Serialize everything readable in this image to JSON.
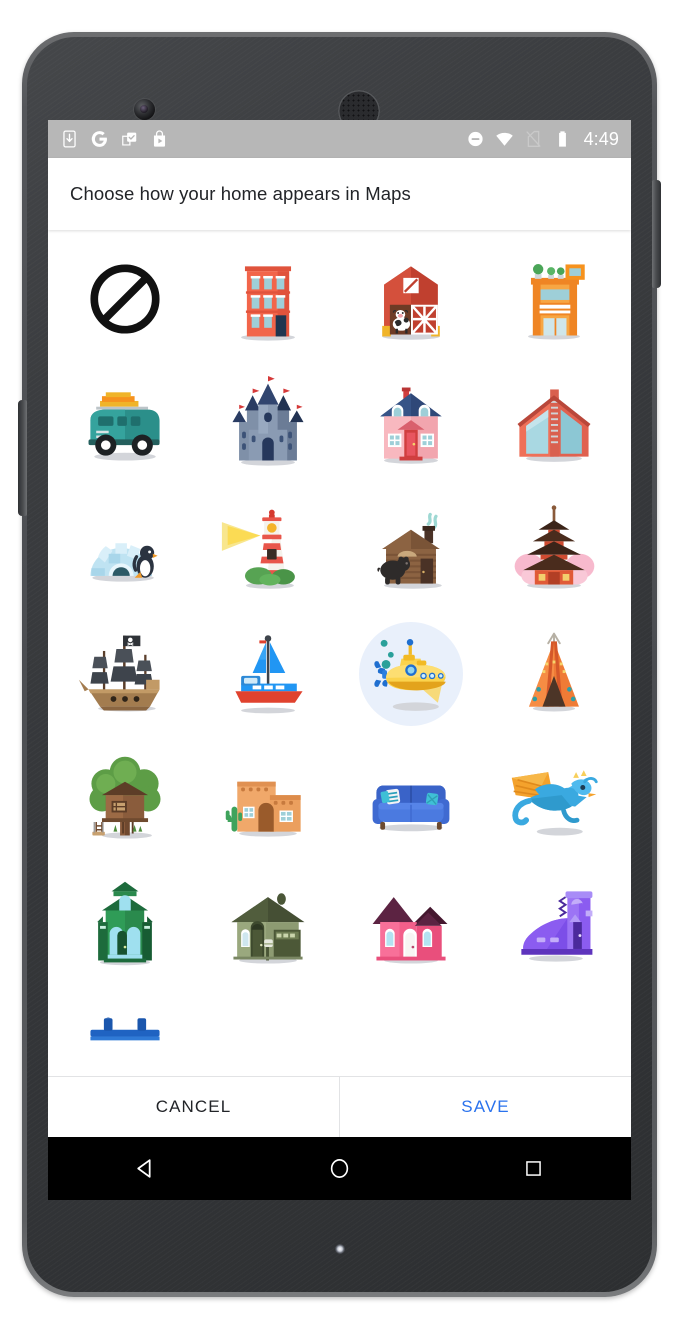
{
  "device": {
    "type": "android-phone",
    "frame_color": "#3b3d40"
  },
  "status_bar": {
    "background": "#b7b7b7",
    "time": "4:49",
    "left_icons": [
      {
        "name": "download-to-device-icon",
        "label": "Download"
      },
      {
        "name": "google-g-icon",
        "label": "Google"
      },
      {
        "name": "app-update-check-icon",
        "label": "App update"
      },
      {
        "name": "play-store-icon",
        "label": "Play Store"
      }
    ],
    "right_icons": [
      {
        "name": "do-not-disturb-icon",
        "label": "Do not disturb"
      },
      {
        "name": "wifi-icon",
        "label": "Wi-Fi"
      },
      {
        "name": "no-sim-icon",
        "label": "No SIM"
      },
      {
        "name": "battery-icon",
        "label": "Battery"
      }
    ]
  },
  "header": {
    "title": "Choose how your home appears in Maps"
  },
  "grid": {
    "columns": 4,
    "selected_index": 14,
    "selection_color": "#e9f0fb",
    "items": [
      {
        "id": "none",
        "label": "None"
      },
      {
        "id": "brownstone",
        "label": "Brownstone apartment"
      },
      {
        "id": "barn",
        "label": "Barn"
      },
      {
        "id": "shop",
        "label": "Shop front"
      },
      {
        "id": "camper-van",
        "label": "Camper van"
      },
      {
        "id": "castle",
        "label": "Castle"
      },
      {
        "id": "suburban-house",
        "label": "Suburban house"
      },
      {
        "id": "modern-house",
        "label": "Modern house"
      },
      {
        "id": "igloo",
        "label": "Igloo"
      },
      {
        "id": "lighthouse",
        "label": "Lighthouse"
      },
      {
        "id": "log-cabin",
        "label": "Log cabin"
      },
      {
        "id": "pagoda",
        "label": "Pagoda"
      },
      {
        "id": "pirate-ship",
        "label": "Pirate ship"
      },
      {
        "id": "sailboat",
        "label": "Sailboat"
      },
      {
        "id": "submarine",
        "label": "Submarine"
      },
      {
        "id": "teepee",
        "label": "Teepee"
      },
      {
        "id": "treehouse",
        "label": "Treehouse"
      },
      {
        "id": "adobe-house",
        "label": "Adobe house"
      },
      {
        "id": "couch",
        "label": "Couch"
      },
      {
        "id": "dragon",
        "label": "Dragon"
      },
      {
        "id": "victorian-house",
        "label": "Victorian house"
      },
      {
        "id": "ranch-house",
        "label": "Ranch house"
      },
      {
        "id": "pink-house",
        "label": "Pink house"
      },
      {
        "id": "boot-house",
        "label": "Boot house"
      },
      {
        "id": "bridge",
        "label": "Bridge"
      },
      {
        "id": "partial-2",
        "label": ""
      },
      {
        "id": "partial-3",
        "label": ""
      },
      {
        "id": "partial-4",
        "label": ""
      }
    ]
  },
  "actions": {
    "cancel_label": "CANCEL",
    "save_label": "SAVE",
    "save_color": "#2a72ed"
  },
  "nav_bar": {
    "background": "#000000",
    "buttons": [
      {
        "name": "nav-back-button",
        "label": "Back"
      },
      {
        "name": "nav-home-button",
        "label": "Home"
      },
      {
        "name": "nav-recents-button",
        "label": "Recents"
      }
    ]
  }
}
